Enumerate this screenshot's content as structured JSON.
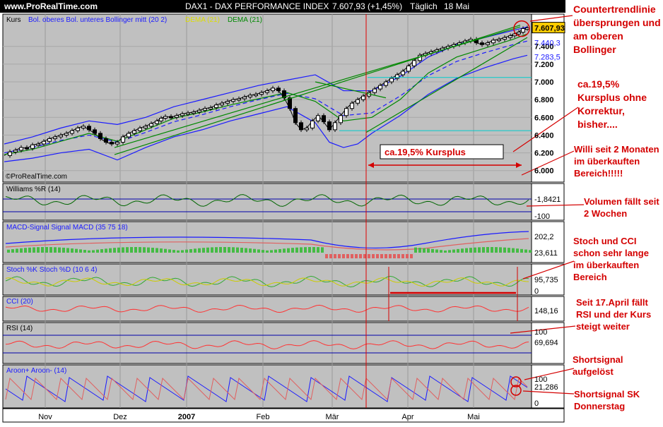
{
  "header": {
    "site": "www.ProRealTime.com",
    "instrument": "DAX1 - DAX PERFORMANCE INDEX",
    "last": "7.607,93 (+1,45%)",
    "period": "Täglich",
    "date": "18 Mai"
  },
  "watermark": "©ProRealTime.com",
  "legend": {
    "kurs": "Kurs",
    "bollinger": "Bol. oberes Bol. unteres Bollinger mitt (20 2)",
    "dema_yellow": "DEMA (21)",
    "dema_green": "DEMA (21)"
  },
  "price_box": {
    "last": "7.607,93",
    "upper": "7.440,3",
    "lower": "7.283,5"
  },
  "chart_data": [
    {
      "type": "line",
      "title": "DAX1 - DAX PERFORMANCE INDEX",
      "x_ticks": [
        "Nov",
        "Dez",
        "2007",
        "Feb",
        "Mär",
        "Apr",
        "Mai"
      ],
      "y_ticks": [
        "6.000",
        "6.200",
        "6.400",
        "6.600",
        "6.800",
        "7.000",
        "7.200",
        "7.400"
      ],
      "ylim": [
        5950,
        7700
      ],
      "series": [
        {
          "name": "Kurs",
          "x": [
            0,
            8,
            16,
            24,
            32,
            40,
            48,
            56,
            64,
            72,
            80,
            88,
            96,
            104,
            112,
            120,
            128,
            136,
            144,
            152,
            160,
            168,
            176,
            184,
            192,
            200,
            208,
            216,
            222,
            228,
            236,
            244,
            252,
            260,
            268,
            276,
            284,
            292,
            300,
            308,
            316,
            324,
            332,
            340,
            348,
            356,
            364,
            372,
            380,
            388,
            396,
            404,
            412,
            420,
            428,
            436,
            444,
            452,
            460,
            468,
            476,
            484,
            492,
            500,
            508,
            516,
            524,
            532,
            540,
            548,
            556,
            564,
            572,
            580,
            588,
            596,
            604,
            612,
            620,
            628,
            636,
            644,
            652,
            660,
            668,
            676,
            684,
            692,
            700,
            708,
            716,
            722,
            728,
            734,
            740
          ],
          "values": [
            6170,
            6210,
            6230,
            6260,
            6250,
            6290,
            6300,
            6330,
            6360,
            6380,
            6400,
            6420,
            6450,
            6480,
            6500,
            6460,
            6420,
            6360,
            6320,
            6300,
            6320,
            6380,
            6420,
            6450,
            6480,
            6500,
            6530,
            6560,
            6590,
            6610,
            6600,
            6620,
            6640,
            6650,
            6660,
            6680,
            6700,
            6710,
            6740,
            6760,
            6780,
            6800,
            6810,
            6830,
            6850,
            6860,
            6880,
            6900,
            6930,
            6900,
            6820,
            6700,
            6540,
            6460,
            6480,
            6560,
            6620,
            6550,
            6460,
            6540,
            6620,
            6700,
            6760,
            6800,
            6840,
            6880,
            6920,
            6960,
            7000,
            7040,
            7080,
            7120,
            7180,
            7240,
            7300,
            7320,
            7340,
            7360,
            7380,
            7400,
            7420,
            7440,
            7460,
            7480,
            7440,
            7420,
            7440,
            7470,
            7480,
            7500,
            7520,
            7540,
            7560,
            7600,
            7608
          ]
        },
        {
          "name": "Bol. oberes",
          "x": [
            0,
            40,
            80,
            120,
            160,
            200,
            240,
            280,
            320,
            360,
            400,
            440,
            480,
            520,
            560,
            600,
            640,
            680,
            720,
            740
          ],
          "values": [
            6300,
            6380,
            6480,
            6560,
            6520,
            6600,
            6720,
            6800,
            6880,
            6960,
            7020,
            7080,
            6900,
            6900,
            7060,
            7280,
            7420,
            7500,
            7580,
            7620
          ]
        },
        {
          "name": "Bol. unteres",
          "x": [
            0,
            40,
            80,
            120,
            160,
            200,
            240,
            280,
            320,
            360,
            400,
            440,
            460,
            480,
            500,
            520,
            560,
            600,
            640,
            680,
            720,
            740
          ],
          "values": [
            6100,
            6140,
            6200,
            6240,
            6120,
            6260,
            6380,
            6460,
            6560,
            6640,
            6720,
            6540,
            6320,
            6260,
            6300,
            6420,
            6620,
            6860,
            7040,
            7160,
            7260,
            7300
          ]
        },
        {
          "name": "Bollinger mitt",
          "x": [
            0,
            40,
            80,
            120,
            160,
            200,
            240,
            280,
            320,
            360,
            400,
            440,
            480,
            520,
            560,
            600,
            640,
            680,
            720,
            740
          ],
          "values": [
            6200,
            6260,
            6340,
            6400,
            6320,
            6430,
            6550,
            6630,
            6720,
            6800,
            6870,
            6810,
            6620,
            6650,
            6840,
            7070,
            7230,
            7330,
            7420,
            7460
          ]
        },
        {
          "name": "DEMA (21)",
          "x": [
            0,
            40,
            80,
            120,
            160,
            200,
            240,
            280,
            320,
            360,
            400,
            440,
            480,
            520,
            560,
            600,
            640,
            680,
            720,
            740
          ],
          "values": [
            6180,
            6240,
            6330,
            6420,
            6330,
            6460,
            6590,
            6660,
            6740,
            6810,
            6880,
            6780,
            6560,
            6600,
            6800,
            7100,
            7280,
            7380,
            7480,
            7540
          ]
        }
      ]
    },
    {
      "type": "line",
      "title": "Williams %R (14)",
      "ylim": [
        -100,
        0
      ],
      "last_value": "-1,8421",
      "y_ticks": [
        "-100"
      ]
    },
    {
      "type": "line",
      "title": "MACD-Signal Signal MACD (35 75 18)",
      "values_shown": [
        "202,2",
        "23,611"
      ]
    },
    {
      "type": "line",
      "title": "Stoch %K Stoch %D (10 6 4)",
      "ylim": [
        0,
        100
      ],
      "last_value": "95,735",
      "y_ticks": [
        "0"
      ]
    },
    {
      "type": "line",
      "title": "CCI (20)",
      "last_value": "148,16"
    },
    {
      "type": "line",
      "title": "RSI (14)",
      "ylim": [
        0,
        100
      ],
      "last_value": "69,694",
      "y_ticks": [
        "100"
      ]
    },
    {
      "type": "line",
      "title": "Aroon+ Aroon- (14)",
      "ylim": [
        0,
        100
      ],
      "values_shown": [
        "100",
        "21,286"
      ],
      "y_ticks": [
        "0"
      ]
    }
  ],
  "axis": {
    "months": [
      "Nov",
      "Dez",
      "2007",
      "Feb",
      "Mär",
      "Apr",
      "Mai"
    ]
  },
  "price_ticks": [
    "7.400",
    "7.200",
    "7.000",
    "6.800",
    "6.600",
    "6.400",
    "6.200",
    "6.000"
  ],
  "callout": "ca.19,5% Kursplus",
  "annotations": {
    "a1": "Countertrendlinie übersprungen und am oberen Bollinger",
    "a2": "ca.19,5% Kursplus ohne Korrektur, bisher....",
    "a3": "Willi seit 2 Monaten im überkauften Bereich!!!!!",
    "a4": "Volumen fällt seit 2 Wochen",
    "a5": "Stoch und CCI schon sehr lange im überkauften Bereich",
    "a6": "Seit 17.April fällt RSI und der Kurs steigt weiter",
    "a7": "Shortsignal aufgelöst",
    "a8": "Shortsignal SK Donnerstag"
  },
  "colors": {
    "bg": "#c0c0c0",
    "annotation": "#d40000",
    "bollinger": "#1a1aff",
    "dema": "#008800",
    "header": "#000000"
  }
}
